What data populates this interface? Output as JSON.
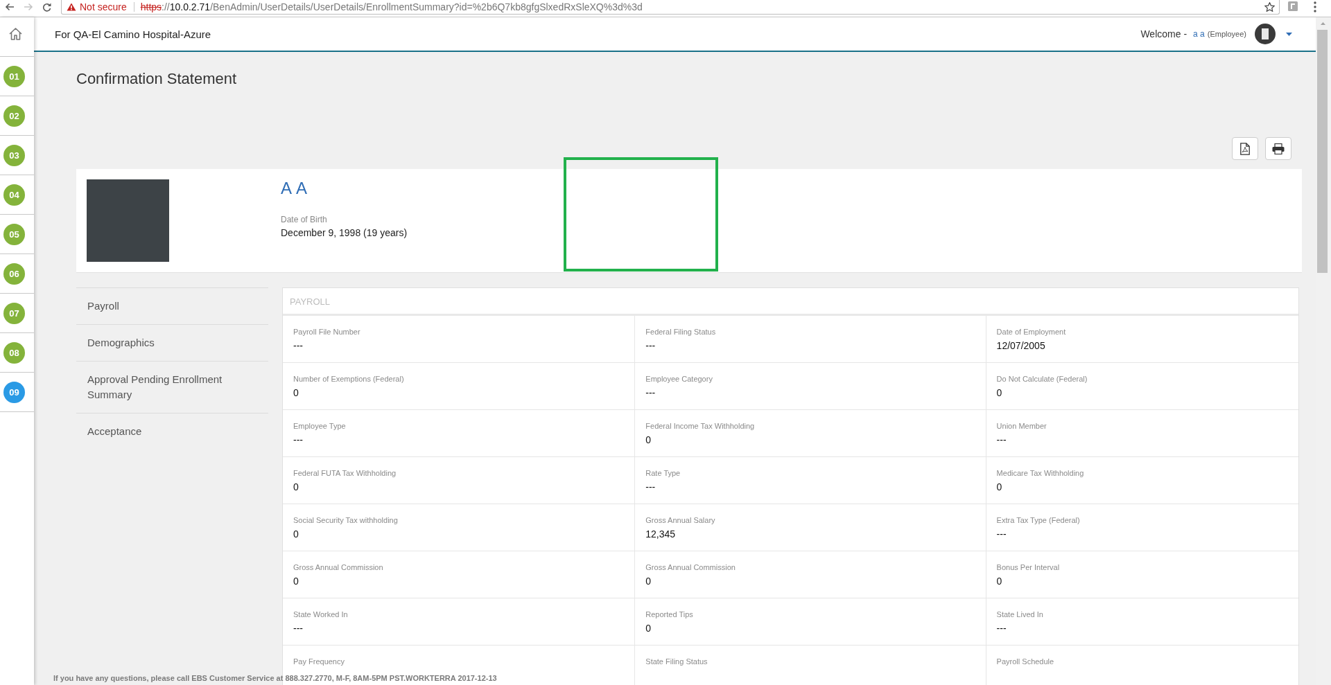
{
  "browser": {
    "security_label": "Not secure",
    "url_scheme": "https",
    "url_separator": "://",
    "url_host": "10.0.2.71",
    "url_path": "/BenAdmin/UserDetails/UserDetails/EnrollmentSummary?id=%2b6Q7kb8gfgSlxedRxSleXQ%3d%3d"
  },
  "steps": [
    {
      "label": "01",
      "selected": false
    },
    {
      "label": "02",
      "selected": false
    },
    {
      "label": "03",
      "selected": false
    },
    {
      "label": "04",
      "selected": false
    },
    {
      "label": "05",
      "selected": false
    },
    {
      "label": "06",
      "selected": false
    },
    {
      "label": "07",
      "selected": false
    },
    {
      "label": "08",
      "selected": false
    },
    {
      "label": "09",
      "selected": true
    }
  ],
  "header": {
    "org_title": "For QA-El Camino Hospital-Azure",
    "welcome_label": "Welcome -",
    "user_name": "a a",
    "user_role": "(Employee)"
  },
  "page_title": "Confirmation Statement",
  "profile": {
    "name": "A A",
    "dob_label": "Date of Birth",
    "dob_value": "December 9, 1998 (19 years)"
  },
  "annotations": [
    {
      "kind": "rectangle"
    }
  ],
  "section_nav": [
    {
      "label": "Payroll"
    },
    {
      "label": "Demographics"
    },
    {
      "label": "Approval Pending Enrollment Summary"
    },
    {
      "label": "Acceptance"
    }
  ],
  "payroll": {
    "title": "PAYROLL",
    "fields": [
      {
        "label": "Payroll File Number",
        "value": "---"
      },
      {
        "label": "Federal Filing Status",
        "value": "---"
      },
      {
        "label": "Date of Employment",
        "value": "12/07/2005"
      },
      {
        "label": "Number of Exemptions (Federal)",
        "value": "0"
      },
      {
        "label": "Employee Category",
        "value": "---"
      },
      {
        "label": "Do Not Calculate (Federal)",
        "value": "0"
      },
      {
        "label": "Employee Type",
        "value": "---"
      },
      {
        "label": "Federal Income Tax Withholding",
        "value": "0"
      },
      {
        "label": "Union Member",
        "value": "---"
      },
      {
        "label": "Federal FUTA Tax Withholding",
        "value": "0"
      },
      {
        "label": "Rate Type",
        "value": "---"
      },
      {
        "label": "Medicare Tax Withholding",
        "value": "0"
      },
      {
        "label": "Social Security Tax withholding",
        "value": "0"
      },
      {
        "label": "Gross Annual Salary",
        "value": "12,345"
      },
      {
        "label": "Extra Tax Type (Federal)",
        "value": "---"
      },
      {
        "label": "Gross Annual Commission",
        "value": "0"
      },
      {
        "label": "Gross Annual Commission",
        "value": "0"
      },
      {
        "label": "Bonus Per Interval",
        "value": "0"
      },
      {
        "label": "State Worked In",
        "value": "---"
      },
      {
        "label": "Reported Tips",
        "value": "0"
      },
      {
        "label": "State Lived In",
        "value": "---"
      },
      {
        "label": "Pay Frequency"
      },
      {
        "label": "State Filing Status"
      },
      {
        "label": "Payroll Schedule"
      }
    ]
  },
  "footer": {
    "text": "If you have any questions, please call EBS Customer Service at 888.327.2770, M-F, 8AM-5PM PST.WORKTERRA 2017-12-13"
  }
}
